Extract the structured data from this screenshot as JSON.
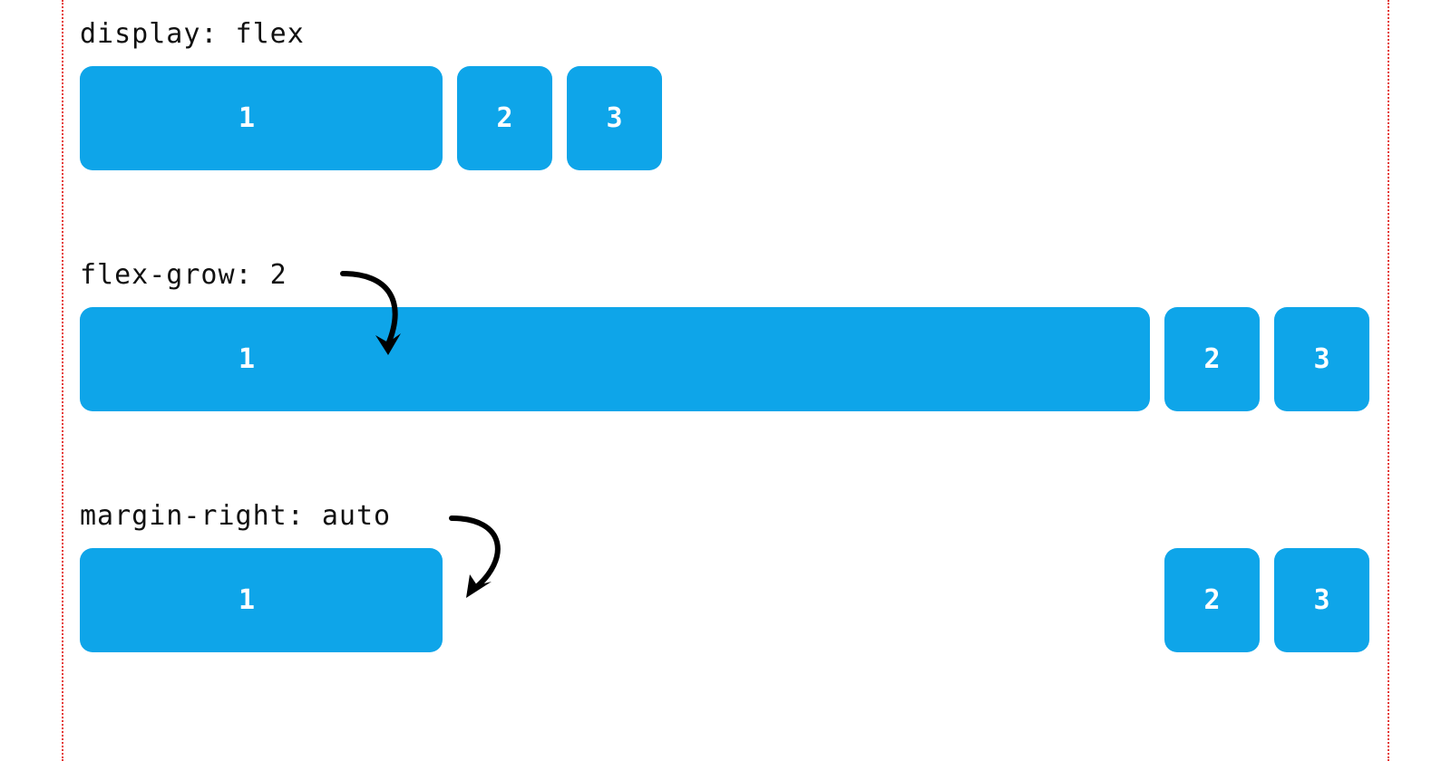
{
  "colors": {
    "box_bg": "#0ea5e9",
    "guide": "#e53935",
    "text": "#111111",
    "box_text": "#ffffff"
  },
  "sections": [
    {
      "label": "display: flex",
      "boxes": [
        "1",
        "2",
        "3"
      ]
    },
    {
      "label": "flex-grow: 2",
      "boxes": [
        "1",
        "2",
        "3"
      ]
    },
    {
      "label": "margin-right: auto",
      "boxes": [
        "1",
        "2",
        "3"
      ]
    }
  ]
}
